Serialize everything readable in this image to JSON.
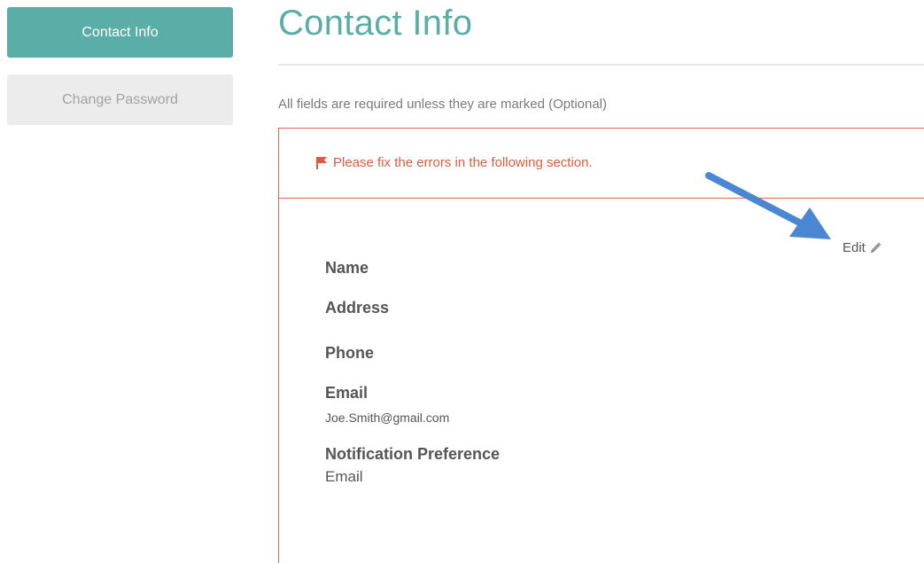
{
  "sidebar": {
    "items": [
      {
        "label": "Contact Info",
        "active": true
      },
      {
        "label": "Change Password",
        "active": false
      }
    ]
  },
  "header": {
    "title": "Contact Info",
    "required_note": "All fields are required unless they are marked (Optional)"
  },
  "panel": {
    "error_message": "Please fix the errors in the following section.",
    "edit_label": "Edit",
    "fields": {
      "name_label": "Name",
      "address_label": "Address",
      "phone_label": "Phone",
      "email_label": "Email",
      "email_value": "Joe.Smith@gmail.com",
      "notification_label": "Notification Preference",
      "notification_value": "Email"
    }
  },
  "colors": {
    "accent": "#5aaea7",
    "error": "#e6644b",
    "inactive_bg": "#ececec",
    "annotation_arrow": "#4a86d1"
  },
  "icons": {
    "error": "flag-icon",
    "edit": "pencil-icon",
    "annotation": "arrow-icon"
  }
}
